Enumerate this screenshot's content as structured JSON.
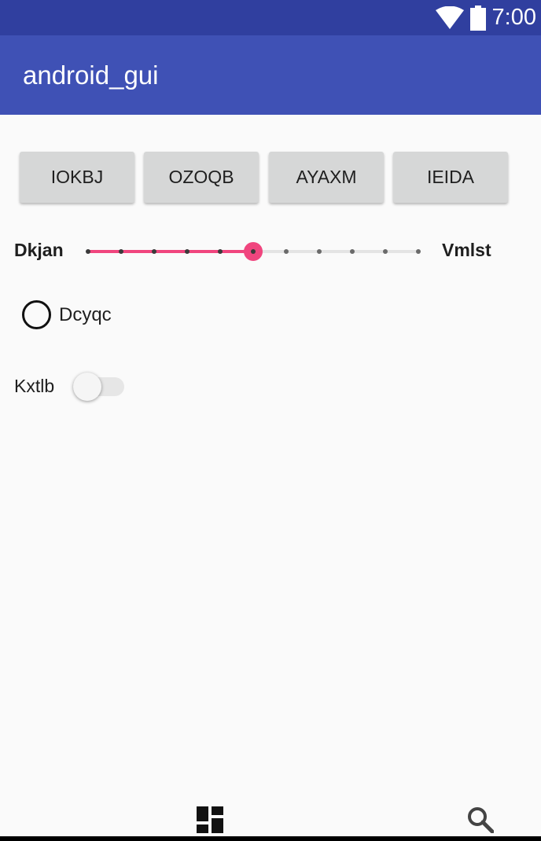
{
  "status_bar": {
    "time": "7:00",
    "background": "#303f9f",
    "icons": [
      "wifi-icon",
      "battery-icon"
    ]
  },
  "app_bar": {
    "title": "android_gui",
    "background": "#3f51b5"
  },
  "buttons": [
    {
      "label": "IOKBJ"
    },
    {
      "label": "OZOQB"
    },
    {
      "label": "AYAXM"
    },
    {
      "label": "IEIDA"
    }
  ],
  "slider": {
    "min_label": "Dkjan",
    "max_label": "Vmlst",
    "steps": 10,
    "value": 5,
    "accent_color": "#f0457e"
  },
  "radio": {
    "label": "Dcyqc",
    "checked": false
  },
  "switch": {
    "label": "Kxtlb",
    "on": false
  },
  "bottom_nav": {
    "icons": [
      "dashboard-icon",
      "search-icon"
    ]
  }
}
